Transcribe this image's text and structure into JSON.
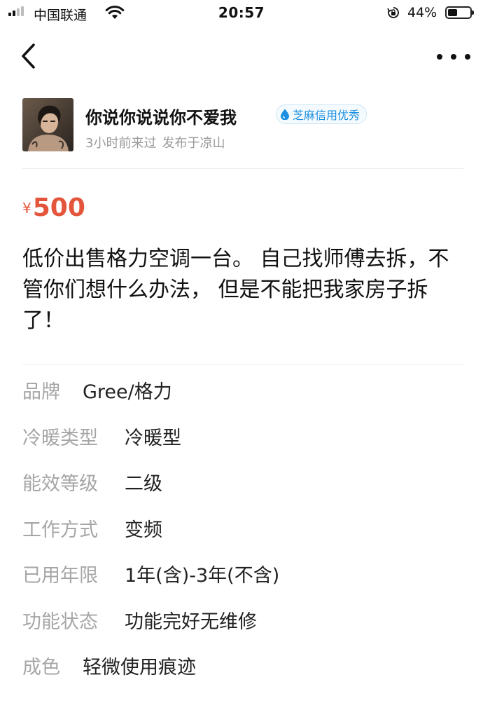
{
  "status_bar": {
    "carrier": "中国联通",
    "time": "20:57",
    "battery_percent_text": "44%",
    "battery_level": 0.44,
    "signal_bars_active": 2,
    "signal_bars_total": 4
  },
  "nav": {
    "back_icon": "chevron-left-icon",
    "more_icon": "more-horizontal-icon"
  },
  "seller": {
    "name": "你说你说说你不爱我",
    "badge": "芝麻信用优秀",
    "last_seen": "3小时前来过",
    "location": "发布于凉山"
  },
  "listing": {
    "currency": "¥",
    "price": "500",
    "price_color": "#e4563b",
    "description": "低价出售格力空调一台。 自己找师傅去拆，不管你们想什么办法， 但是不能把我家房子拆了！"
  },
  "params": [
    {
      "label": "品牌",
      "value": "Gree/格力"
    },
    {
      "label": "冷暖类型",
      "value": "冷暖型"
    },
    {
      "label": "能效等级",
      "value": "二级"
    },
    {
      "label": "工作方式",
      "value": "变频"
    },
    {
      "label": "已用年限",
      "value": "1年(含)-3年(不含)"
    },
    {
      "label": "功能状态",
      "value": "功能完好无维修"
    },
    {
      "label": "成色",
      "value": "轻微使用痕迹"
    }
  ]
}
